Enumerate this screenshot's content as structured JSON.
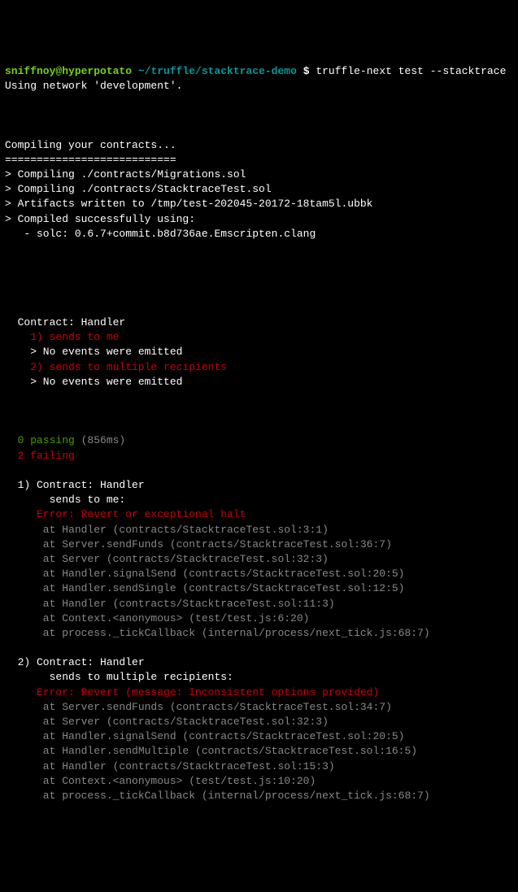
{
  "prompt": {
    "user_host": "sniffnoy@hyperpotato",
    "path": "~/truffle/stacktrace-demo",
    "symbol": "$",
    "command": "truffle-next test --stacktrace"
  },
  "network_line": "Using network 'development'.",
  "compile_header": "Compiling your contracts...",
  "compile_separator": "===========================",
  "compile_lines": [
    "> Compiling ./contracts/Migrations.sol",
    "> Compiling ./contracts/StacktraceTest.sol",
    "> Artifacts written to /tmp/test-202045-20172-18tam5l.ubbk",
    "> Compiled successfully using:",
    "   - solc: 0.6.7+commit.b8d736ae.Emscripten.clang"
  ],
  "contract_header": "  Contract: Handler",
  "test1_fail": "    1) sends to me",
  "test1_noevents": "    > No events were emitted",
  "test2_fail": "    2) sends to multiple recipients",
  "test2_noevents": "    > No events were emitted",
  "passing": {
    "count": "  0 passing",
    "time": " (856ms)"
  },
  "failing": "  2 failing",
  "error1": {
    "header": "  1) Contract: Handler",
    "subheader": "       sends to me:",
    "error_msg": "     Error: Revert or exceptional halt",
    "stack": [
      "      at Handler (contracts/StacktraceTest.sol:3:1)",
      "      at Server.sendFunds (contracts/StacktraceTest.sol:36:7)",
      "      at Server (contracts/StacktraceTest.sol:32:3)",
      "      at Handler.signalSend (contracts/StacktraceTest.sol:20:5)",
      "      at Handler.sendSingle (contracts/StacktraceTest.sol:12:5)",
      "      at Handler (contracts/StacktraceTest.sol:11:3)",
      "      at Context.<anonymous> (test/test.js:6:20)",
      "      at process._tickCallback (internal/process/next_tick.js:68:7)"
    ]
  },
  "error2": {
    "header": "  2) Contract: Handler",
    "subheader": "       sends to multiple recipients:",
    "error_msg": "     Error: Revert (message: Inconsistent options provided)",
    "stack": [
      "      at Server.sendFunds (contracts/StacktraceTest.sol:34:7)",
      "      at Server (contracts/StacktraceTest.sol:32:3)",
      "      at Handler.signalSend (contracts/StacktraceTest.sol:20:5)",
      "      at Handler.sendMultiple (contracts/StacktraceTest.sol:16:5)",
      "      at Handler (contracts/StacktraceTest.sol:15:3)",
      "      at Context.<anonymous> (test/test.js:10:20)",
      "      at process._tickCallback (internal/process/next_tick.js:68:7)"
    ]
  }
}
